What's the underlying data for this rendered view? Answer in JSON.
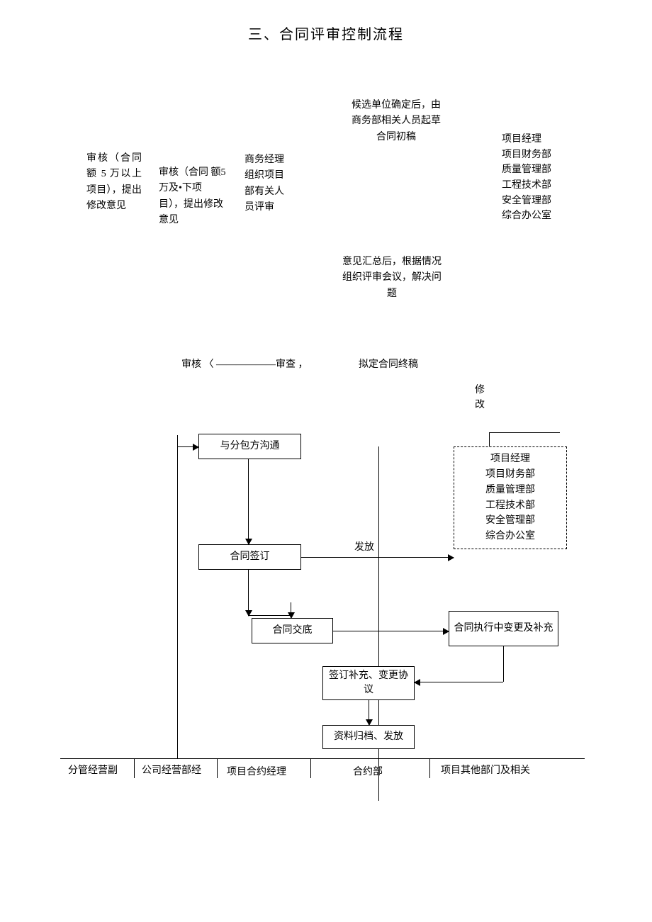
{
  "title": "三、合同评审控制流程",
  "top_texts": {
    "t1": "候选单位确定后，由商务部相关人员起草合同初稿",
    "t2_dept": "项目经理\n项目财务部\n质量管理部\n工程技术部\n安全管理部\n综合办公室",
    "t3": "审核（合同额 5 万以上项目），提出修改意见",
    "t4": "审核（合同 额5 万及•下项目），提出修改 意见",
    "t5": "商务经理组织项目部有关人员评审",
    "t6": "意见汇总后，根据情况组织评审会议，解决问题",
    "t7": "审核 〈 ——————审查 ，",
    "t8": "拟定合同终稿",
    "t9": "修\n改"
  },
  "flow": {
    "b1": "与分包方沟通",
    "b2": "项目经理\n项目财务部\n质量管理部\n工程技术部\n安全管理部\n综合办公室",
    "b3": "合同签订",
    "b3_label": "发放",
    "b4": "合同交底",
    "b5": "合同执行中变更及补充",
    "b6": "签订补充、变更协议",
    "b7": "资料归档、发放"
  },
  "lanes": {
    "l1": "分管经营副",
    "l2": "公司经营部经",
    "l3": "项目合约经理",
    "l4": "合约部",
    "l5": "项目其他部门及相关"
  }
}
